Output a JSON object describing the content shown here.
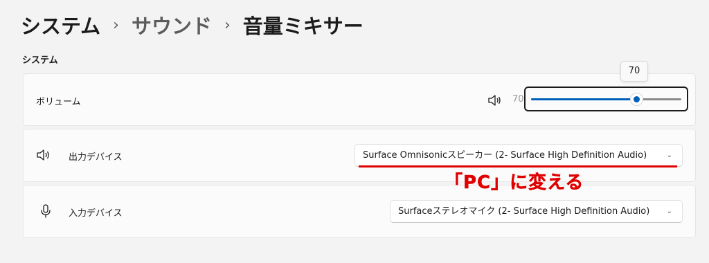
{
  "breadcrumb": {
    "items": [
      "システム",
      "サウンド",
      "音量ミキサー"
    ],
    "separator": "›"
  },
  "section": {
    "title": "システム"
  },
  "volume": {
    "label": "ボリューム",
    "value_text": "70",
    "tooltip": "70",
    "level": 70,
    "icon": "speaker-icon",
    "accent_color": "#005fb8"
  },
  "output": {
    "label": "出力デバイス",
    "icon": "speaker-icon",
    "selected": "Surface Omnisonicスピーカー (2- Surface High Definition Audio)"
  },
  "input": {
    "label": "入力デバイス",
    "icon": "microphone-icon",
    "selected": "Surfaceステレオマイク (2- Surface High Definition Audio)"
  },
  "annotation": {
    "text": "「PC」に変える",
    "color": "#e00000"
  }
}
